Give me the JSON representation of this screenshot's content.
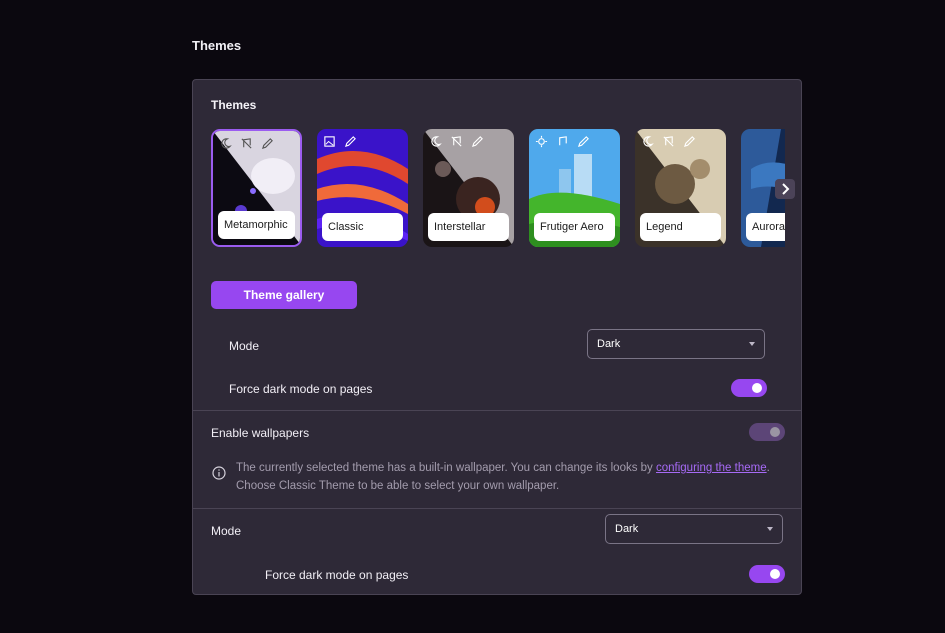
{
  "page_title": "Themes",
  "section_title": "Themes",
  "themes": [
    {
      "label": "Metamorphic",
      "selected": true
    },
    {
      "label": "Classic",
      "selected": false
    },
    {
      "label": "Interstellar",
      "selected": false
    },
    {
      "label": "Frutiger Aero",
      "selected": false
    },
    {
      "label": "Legend",
      "selected": false
    },
    {
      "label": "Aurora",
      "selected": false
    }
  ],
  "gallery_button": "Theme gallery",
  "mode_label": "Mode",
  "mode_value": "Dark",
  "force_dark_label": "Force dark mode on pages",
  "force_dark_on": true,
  "wallpapers_label": "Enable wallpapers",
  "wallpapers_on": true,
  "info": {
    "text_before": "The currently selected theme has a built-in wallpaper. You can change its looks by ",
    "link": "configuring the theme",
    "text_after": ".",
    "line2": "Choose Classic Theme to be able to select your own wallpaper."
  },
  "mode2_label": "Mode",
  "mode2_value": "Dark",
  "force_dark2_label": "Force dark mode on pages",
  "force_dark2_on": true,
  "colors": {
    "accent": "#9747f0",
    "panel": "#2e2937",
    "background": "#0b080f"
  },
  "icons": [
    "info-icon",
    "chevron-right-icon",
    "chevron-down-icon",
    "moon-icon",
    "music-off-icon",
    "pencil-icon",
    "sun-icon"
  ]
}
